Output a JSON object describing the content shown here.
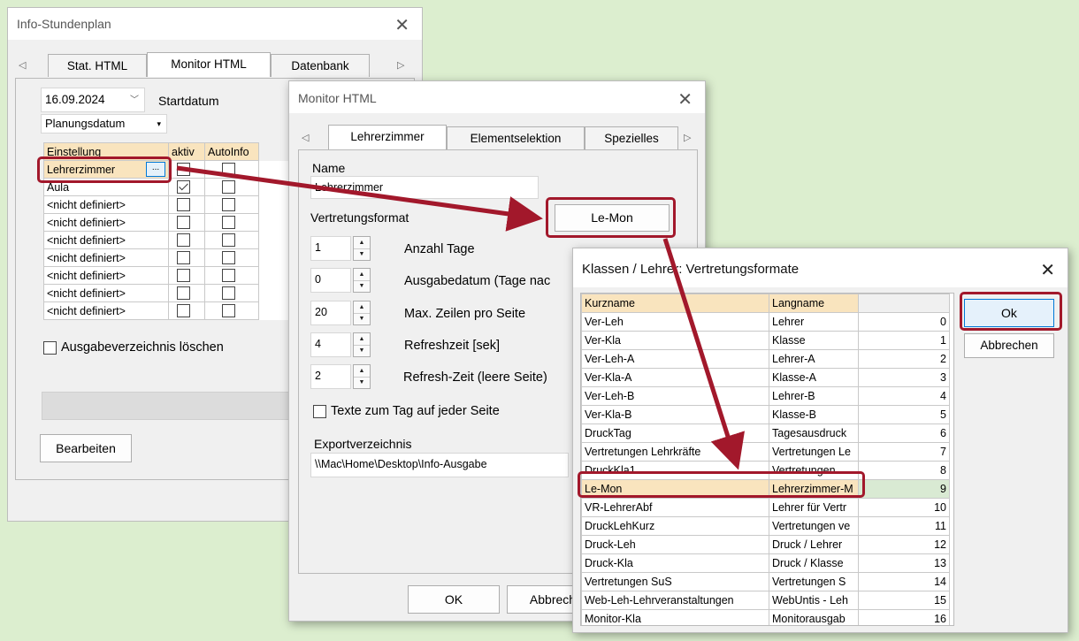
{
  "info_window": {
    "title": "Info-Stundenplan",
    "tabs": [
      "Stat. HTML",
      "Monitor HTML",
      "Datenbank"
    ],
    "date_value": "16.09.2024",
    "date_label": "Startdatum",
    "date_type": "Planungsdatum",
    "grid_headers": [
      "Einstellung",
      "aktiv",
      "AutoInfo"
    ],
    "rows": [
      {
        "name": "Lehrerzimmer",
        "aktiv": false,
        "auto": false
      },
      {
        "name": "Aula",
        "aktiv": true,
        "auto": false
      },
      {
        "name": "<nicht definiert>",
        "aktiv": false,
        "auto": false
      },
      {
        "name": "<nicht definiert>",
        "aktiv": false,
        "auto": false
      },
      {
        "name": "<nicht definiert>",
        "aktiv": false,
        "auto": false
      },
      {
        "name": "<nicht definiert>",
        "aktiv": false,
        "auto": false
      },
      {
        "name": "<nicht definiert>",
        "aktiv": false,
        "auto": false
      },
      {
        "name": "<nicht definiert>",
        "aktiv": false,
        "auto": false
      },
      {
        "name": "<nicht definiert>",
        "aktiv": false,
        "auto": false
      }
    ],
    "ellipsis_label": "...",
    "delete_dir_label": "Ausgabeverzeichnis löschen",
    "edit_button": "Bearbeiten"
  },
  "monitor_window": {
    "title": "Monitor HTML",
    "tabs": [
      "Lehrerzimmer",
      "Elementselektion",
      "Spezielles"
    ],
    "name_label": "Name",
    "name_value": "Lehrerzimmer",
    "format_label": "Vertretungsformat",
    "format_button": "Le-Mon",
    "spinners": [
      {
        "value": "1",
        "label": "Anzahl Tage"
      },
      {
        "value": "0",
        "label": "Ausgabedatum (Tage nac"
      },
      {
        "value": "20",
        "label": "Max. Zeilen pro Seite"
      },
      {
        "value": "4",
        "label": "Refreshzeit [sek]"
      },
      {
        "value": "2",
        "label": "Refresh-Zeit (leere Seite)"
      }
    ],
    "texts_label": "Texte zum Tag auf jeder Seite",
    "export_label": "Exportverzeichnis",
    "export_value": "\\\\Mac\\Home\\Desktop\\Info-Ausgabe",
    "ok_button": "OK",
    "cancel_button": "Abbrech"
  },
  "formats_window": {
    "title": "Klassen / Lehrer: Vertretungsformate",
    "headers": [
      "Kurzname",
      "Langname",
      ""
    ],
    "rows": [
      [
        "Ver-Leh",
        "Lehrer",
        "0"
      ],
      [
        "Ver-Kla",
        "Klasse",
        "1"
      ],
      [
        "Ver-Leh-A",
        "Lehrer-A",
        "2"
      ],
      [
        "Ver-Kla-A",
        "Klasse-A",
        "3"
      ],
      [
        "Ver-Leh-B",
        "Lehrer-B",
        "4"
      ],
      [
        "Ver-Kla-B",
        "Klasse-B",
        "5"
      ],
      [
        "DruckTag",
        "Tagesausdruck",
        "6"
      ],
      [
        "Vertretungen Lehrkräfte",
        "Vertretungen Le",
        "7"
      ],
      [
        "DruckKla1",
        "Vertretungen",
        "8"
      ],
      [
        "Le-Mon",
        "Lehrerzimmer-M",
        "9"
      ],
      [
        "VR-LehrerAbf",
        "Lehrer für Vertr",
        "10"
      ],
      [
        "DruckLehKurz",
        "Vertretungen ve",
        "11"
      ],
      [
        "Druck-Leh",
        "Druck / Lehrer",
        "12"
      ],
      [
        "Druck-Kla",
        "Druck / Klasse",
        "13"
      ],
      [
        "Vertretungen SuS",
        "Vertretungen S",
        "14"
      ],
      [
        "Web-Leh-Lehrveranstaltungen",
        "WebUntis - Leh",
        "15"
      ],
      [
        "Monitor-Kla",
        "Monitorausgab",
        "16"
      ]
    ],
    "ok_button": "Ok",
    "cancel_button": "Abbrechen"
  },
  "colors": {
    "highlight": "#a2182b",
    "header_bg": "#f9e4be",
    "background": "#dceecf"
  }
}
